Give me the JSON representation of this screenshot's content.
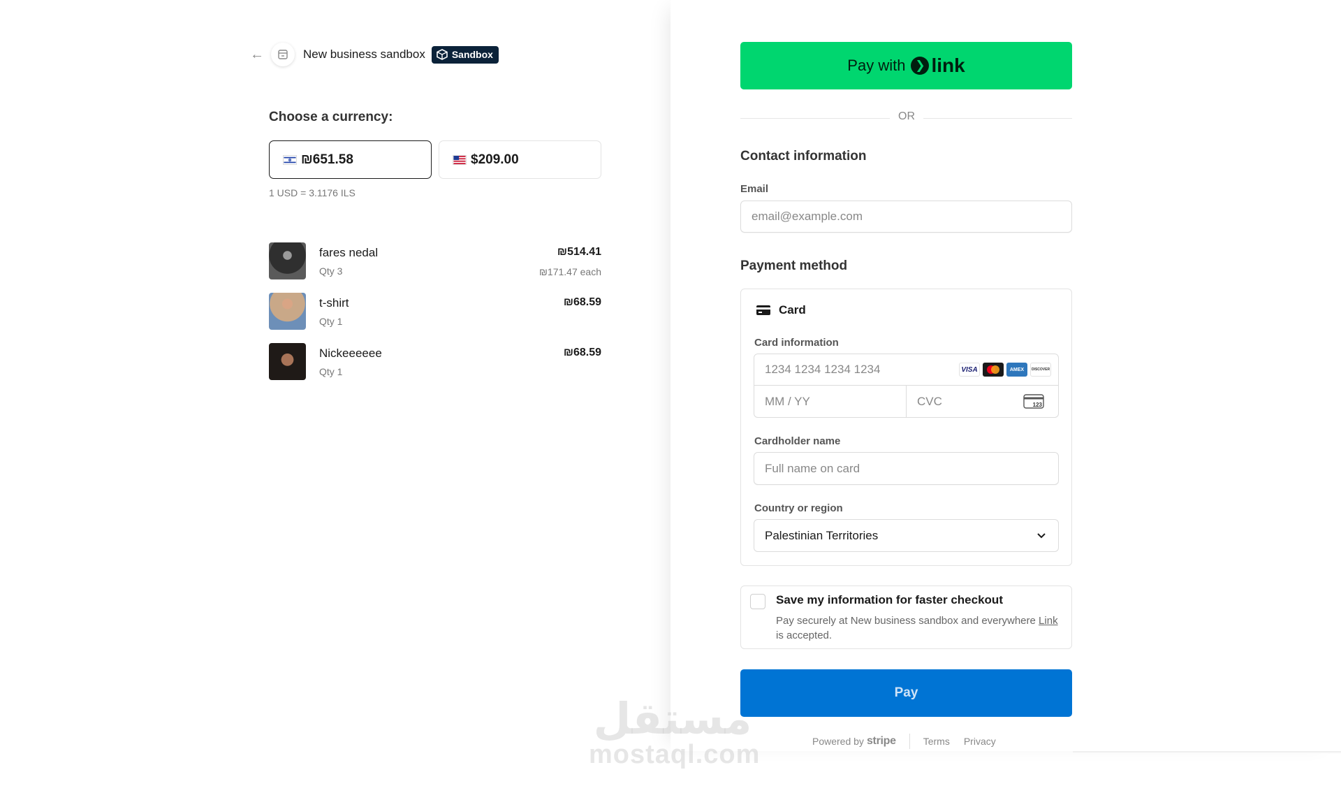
{
  "header": {
    "business_name": "New business sandbox",
    "badge_label": "Sandbox"
  },
  "currency": {
    "label": "Choose a currency:",
    "options": [
      {
        "amount": "₪651.58",
        "flag": "israel-flag-icon",
        "selected": true
      },
      {
        "amount": "$209.00",
        "flag": "us-flag-icon",
        "selected": false
      }
    ],
    "rate": "1 USD = 3.1176 ILS"
  },
  "items": [
    {
      "name": "fares nedal",
      "qty": "Qty 3",
      "price": "₪514.41",
      "each": "₪171.47 each",
      "thumb_color": "#3b3b3b"
    },
    {
      "name": "t-shirt",
      "qty": "Qty 1",
      "price": "₪68.59",
      "each": "",
      "thumb_color": "#b98a6a"
    },
    {
      "name": "Nickeeeeee",
      "qty": "Qty 1",
      "price": "₪68.59",
      "each": "",
      "thumb_color": "#1f1a17"
    }
  ],
  "link_button": {
    "label": "Pay with",
    "logo": "link"
  },
  "or_label": "OR",
  "contact": {
    "title": "Contact information",
    "email_label": "Email",
    "email_placeholder": "email@example.com"
  },
  "payment": {
    "title": "Payment method",
    "card_label": "Card",
    "card_info_label": "Card information",
    "card_number_placeholder": "1234 1234 1234 1234",
    "expiry_placeholder": "MM / YY",
    "cvc_placeholder": "CVC",
    "brands": [
      "VISA",
      "MC",
      "AMEX",
      "DISCOVER"
    ],
    "cardholder_label": "Cardholder name",
    "cardholder_placeholder": "Full name on card",
    "country_label": "Country or region",
    "country_value": "Palestinian Territories"
  },
  "save": {
    "title": "Save my information for faster checkout",
    "desc_before": "Pay securely at New business sandbox and everywhere ",
    "desc_link": "Link",
    "desc_after": " is accepted."
  },
  "pay_button": "Pay",
  "footer": {
    "powered_by": "Powered by",
    "stripe": "stripe",
    "terms": "Terms",
    "privacy": "Privacy"
  },
  "watermark": {
    "arabic": "مستقل",
    "latin": "mostaql.com"
  },
  "colors": {
    "link_green": "#00d66f",
    "pay_blue": "#0074d4",
    "badge_navy": "#0b2239"
  }
}
